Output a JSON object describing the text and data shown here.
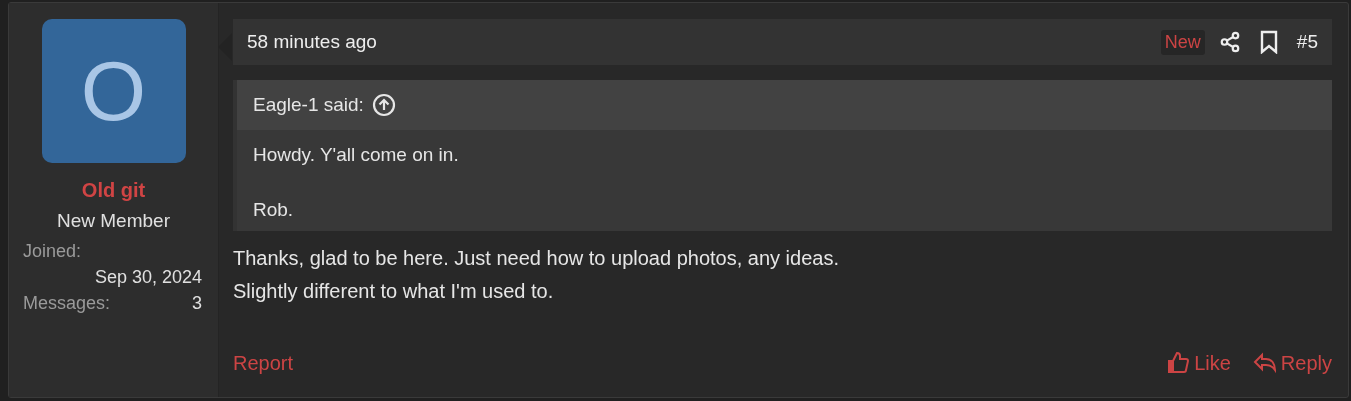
{
  "author": {
    "avatar_letter": "O",
    "name": "Old git",
    "title": "New Member",
    "stats": [
      {
        "label": "Joined:",
        "value": "Sep 30, 2024",
        "kind": "stacked"
      },
      {
        "label": "Messages:",
        "value": "3",
        "kind": "inline"
      }
    ]
  },
  "post": {
    "time": "58 minutes ago",
    "new_badge": "New",
    "number": "#5",
    "quote": {
      "attribution": "Eagle-1 said:",
      "lines": [
        "Howdy. Y'all come on in.",
        "Rob."
      ]
    },
    "body": [
      "Thanks, glad to be here. Just need how to upload photos, any ideas.",
      "Slightly different to what I'm used to."
    ],
    "report": "Report",
    "actions": [
      {
        "kind": "like",
        "label": "Like"
      },
      {
        "kind": "reply",
        "label": "Reply"
      }
    ]
  }
}
